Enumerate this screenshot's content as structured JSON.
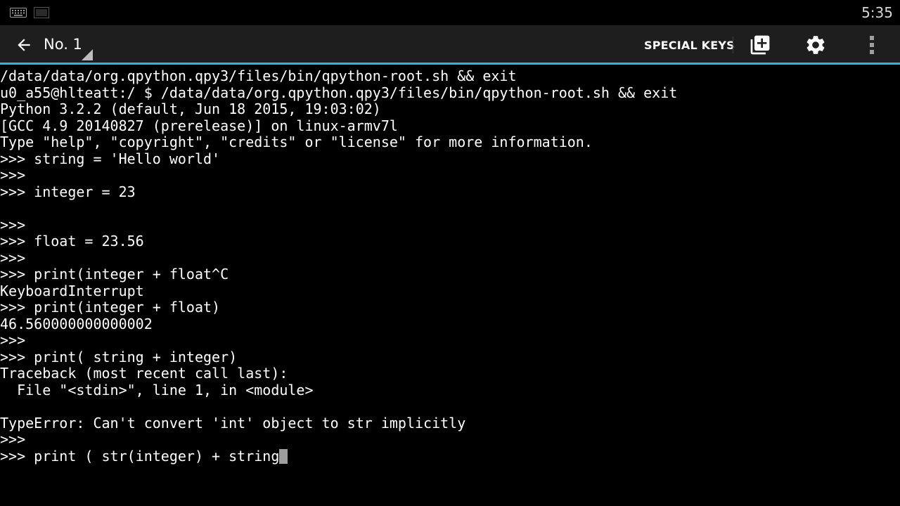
{
  "status_bar": {
    "time": "5:35",
    "icons": [
      "keyboard-icon",
      "screen-icon"
    ]
  },
  "action_bar": {
    "window_title": "No. 1",
    "special_keys_label": "SPECIAL KEYS",
    "icons": [
      "back-arrow-icon",
      "add-window-icon",
      "gear-icon",
      "overflow-menu-icon"
    ],
    "accent_color": "#33b5e5"
  },
  "terminal": {
    "lines": [
      "/data/data/org.qpython.qpy3/files/bin/qpython-root.sh && exit",
      "u0_a55@hlteatt:/ $ /data/data/org.qpython.qpy3/files/bin/qpython-root.sh && exit",
      "Python 3.2.2 (default, Jun 18 2015, 19:03:02)",
      "[GCC 4.9 20140827 (prerelease)] on linux-armv7l",
      "Type \"help\", \"copyright\", \"credits\" or \"license\" for more information.",
      ">>> string = 'Hello world'",
      ">>>",
      ">>> integer = 23",
      "",
      ">>>",
      ">>> float = 23.56",
      ">>>",
      ">>> print(integer + float^C",
      "KeyboardInterrupt",
      ">>> print(integer + float)",
      "46.560000000000002",
      ">>>",
      ">>> print( string + integer)",
      "Traceback (most recent call last):",
      "  File \"<stdin>\", line 1, in <module>",
      "",
      "TypeError: Can't convert 'int' object to str implicitly",
      ">>>",
      ">>> print ( str(integer) + string"
    ]
  }
}
